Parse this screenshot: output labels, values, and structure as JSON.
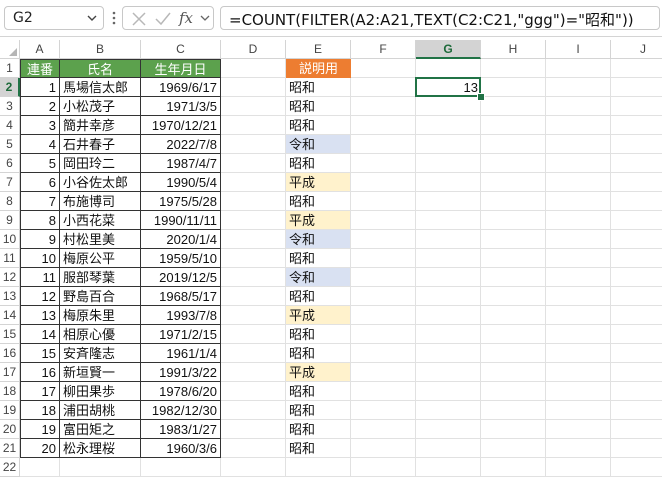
{
  "namebox": {
    "value": "G2"
  },
  "formula": {
    "text": "=COUNT(FILTER(A2:A21,TEXT(C2:C21,\"ggg\")=\"昭和\"))"
  },
  "columns": [
    "A",
    "B",
    "C",
    "D",
    "E",
    "F",
    "G",
    "H",
    "I",
    "J"
  ],
  "rows": [
    "1",
    "2",
    "3",
    "4",
    "5",
    "6",
    "7",
    "8",
    "9",
    "10",
    "11",
    "12",
    "13",
    "14",
    "15",
    "16",
    "17",
    "18",
    "19",
    "20",
    "21",
    "22"
  ],
  "selected": {
    "col": "G",
    "row": "2"
  },
  "colors": {
    "header_green": "#5ca14d",
    "header_orange": "#ed7d31",
    "reiwa_fill": "#d9e1f2",
    "heisei_fill": "#fff2cc",
    "selection": "#217346"
  },
  "table": {
    "headers": [
      "連番",
      "氏名",
      "生年月日"
    ],
    "rows": [
      [
        "1",
        "馬場信太郎",
        "1969/6/17"
      ],
      [
        "2",
        "小松茂子",
        "1971/3/5"
      ],
      [
        "3",
        "簡井幸彦",
        "1970/12/21"
      ],
      [
        "4",
        "石井春子",
        "2022/7/8"
      ],
      [
        "5",
        "岡田玲二",
        "1987/4/7"
      ],
      [
        "6",
        "小谷佐太郎",
        "1990/5/4"
      ],
      [
        "7",
        "布施博司",
        "1975/5/28"
      ],
      [
        "8",
        "小西花菜",
        "1990/11/11"
      ],
      [
        "9",
        "村松里美",
        "2020/1/4"
      ],
      [
        "10",
        "梅原公平",
        "1959/5/10"
      ],
      [
        "11",
        "服部琴葉",
        "2019/12/5"
      ],
      [
        "12",
        "野島百合",
        "1968/5/17"
      ],
      [
        "13",
        "梅原朱里",
        "1993/7/8"
      ],
      [
        "14",
        "相原心優",
        "1971/2/15"
      ],
      [
        "15",
        "安斉隆志",
        "1961/1/4"
      ],
      [
        "16",
        "新垣賢一",
        "1991/3/22"
      ],
      [
        "17",
        "柳田果歩",
        "1978/6/20"
      ],
      [
        "18",
        "浦田胡桃",
        "1982/12/30"
      ],
      [
        "19",
        "富田矩之",
        "1983/1/27"
      ],
      [
        "20",
        "松永理桜",
        "1960/3/6"
      ]
    ]
  },
  "explain": {
    "header": "説明用",
    "values": [
      "昭和",
      "昭和",
      "昭和",
      "令和",
      "昭和",
      "平成",
      "昭和",
      "平成",
      "令和",
      "昭和",
      "令和",
      "昭和",
      "平成",
      "昭和",
      "昭和",
      "平成",
      "昭和",
      "昭和",
      "昭和",
      "昭和"
    ]
  },
  "result": {
    "value": "13"
  },
  "icons": {
    "namebox_dropdown": "chevron-down-icon",
    "cancel": "cancel-x-icon",
    "enter": "enter-check-icon",
    "function": "fx-icon",
    "more": "vertical-dots-icon"
  }
}
